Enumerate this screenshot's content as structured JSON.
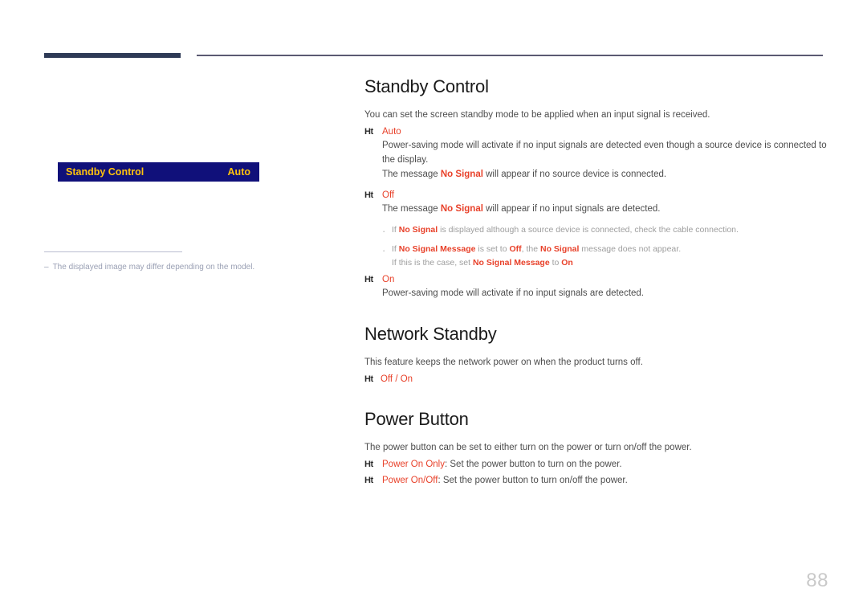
{
  "page": {
    "number": "88"
  },
  "osd_preview": {
    "label": "Standby Control",
    "value": "Auto",
    "bar_color": "#10107a",
    "text_color": "#ffc20e"
  },
  "note": {
    "dash": "–",
    "text": "The displayed image may differ depending on the model."
  },
  "accent_color": "#e8412a",
  "sections": [
    {
      "title": "Standby Control",
      "intro": "You can set the screen standby mode to be applied when an input signal is received.",
      "options": [
        {
          "marker": "Ht",
          "term": "Auto",
          "lines": [
            "Power-saving mode will activate if no input signals are detected even though a source device is connected to the display.",
            "The message No Signal will appear if no source device is connected."
          ]
        },
        {
          "marker": "Ht",
          "term": "Off",
          "lines": [
            "The message No Signal will appear if no input signals are detected."
          ],
          "sub_bullets": [
            "If No Signal is displayed although a source device is connected, check the cable connection.",
            "If No Signal Message is set to Off, the No Signal message does not appear.",
            "If this is the case, set No Signal Message to On"
          ]
        },
        {
          "marker": "Ht",
          "term": "On",
          "lines": [
            "Power-saving mode will activate if no input signals are detected."
          ]
        }
      ]
    },
    {
      "title": "Network Standby",
      "intro": "This feature keeps the network power on when the product turns off.",
      "options": [
        {
          "marker": "Ht",
          "term": "Off / On",
          "lines": []
        }
      ]
    },
    {
      "title": "Power Button",
      "intro": "The power button can be set to either turn on the power or turn on/off the power.",
      "options": [
        {
          "marker": "Ht",
          "term": "Power On Only",
          "inline_desc": ": Set the power button to turn on the power."
        },
        {
          "marker": "Ht",
          "term": "Power On/Off",
          "inline_desc": ": Set the power button to turn on/off the power."
        }
      ]
    }
  ]
}
